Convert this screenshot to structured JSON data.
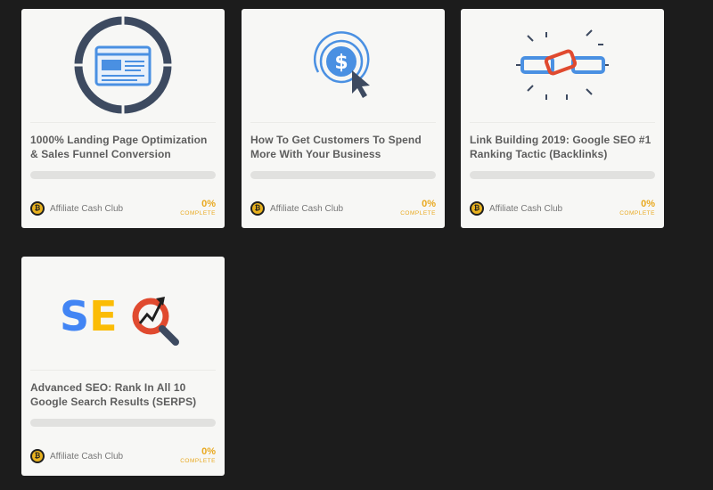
{
  "courses": [
    {
      "title": "1000% Landing Page Optimization & Sales Funnel Conversion",
      "icon": "browser-window-ring-icon",
      "author": "Affiliate Cash Club",
      "progress_percent": 0,
      "progress_text": "0%",
      "progress_label": "COMPLETE"
    },
    {
      "title": "How To Get Customers To Spend More With Your Business",
      "icon": "dollar-cursor-icon",
      "author": "Affiliate Cash Club",
      "progress_percent": 0,
      "progress_text": "0%",
      "progress_label": "COMPLETE"
    },
    {
      "title": "Link Building 2019: Google SEO #1 Ranking Tactic (Backlinks)",
      "icon": "chain-links-icon",
      "author": "Affiliate Cash Club",
      "progress_percent": 0,
      "progress_text": "0%",
      "progress_label": "COMPLETE"
    },
    {
      "title": "Advanced SEO: Rank In All 10 Google Search Results (SERPS)",
      "icon": "seo-magnifier-icon",
      "icon_text": "SEO",
      "author": "Affiliate Cash Club",
      "progress_percent": 0,
      "progress_text": "0%",
      "progress_label": "COMPLETE"
    }
  ],
  "colors": {
    "background": "#1c1c1c",
    "card": "#f7f7f5",
    "accent": "#e9a920",
    "navy": "#3d4a60",
    "blue": "#4a90e2",
    "red": "#e04a2f",
    "seo_blue": "#4285f4",
    "seo_yellow": "#fbbc05"
  }
}
